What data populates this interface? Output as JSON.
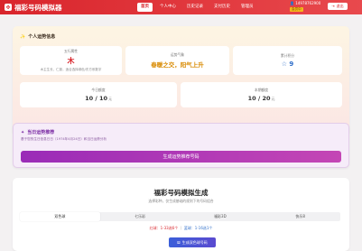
{
  "header": {
    "logo_icon": "clover-icon",
    "title": "福彩号码模拟器",
    "nav": [
      {
        "label": "首页",
        "active": true
      },
      {
        "label": "个人中心",
        "active": false
      },
      {
        "label": "历史记录",
        "active": false
      },
      {
        "label": "支付历史",
        "active": false
      },
      {
        "label": "管理员",
        "active": false
      }
    ],
    "user": {
      "phone": "14978762900",
      "badge": "会员中",
      "logout_label": "退出"
    }
  },
  "fortune": {
    "title": "个人运势信息",
    "element": {
      "label": "五行属性",
      "value": "木",
      "sub": "木主生长、仁慈，适合选择绿色/东方系数字"
    },
    "luck": {
      "label": "运势气象",
      "value": "春暖之交，阳气上升"
    },
    "score": {
      "label": "累计积分",
      "value": "9"
    },
    "today_quota": {
      "label": "今日额度",
      "value": "10 / 10",
      "unit": "元"
    },
    "month_quota": {
      "label": "本期额度",
      "value": "10 / 20",
      "unit": "元"
    }
  },
  "lucky": {
    "title": "当日运势推荐",
    "desc": "基于您的生日信息日日（1974年4月24日）和当日运势分析",
    "button": "生成运势推荐号码"
  },
  "generator": {
    "title": "福彩号码模拟生成",
    "desc": "选择彩种，仅生成基础的规则下的号码组合",
    "tabs": [
      {
        "label": "双色球",
        "active": true
      },
      {
        "label": "七乐彩",
        "active": false
      },
      {
        "label": "福彩3D",
        "active": false
      },
      {
        "label": "快乐8",
        "active": false
      }
    ],
    "rule_red": "红球：1-33选6个",
    "rule_sep": "｜",
    "rule_blue": "蓝球：1-16选1个",
    "button": "生成双色球号码"
  },
  "colors": {
    "brand_red": "#d9252c",
    "accent_purple": "#9a2bb7",
    "accent_blue": "#3b5fd9",
    "gold": "#f5b81b"
  }
}
